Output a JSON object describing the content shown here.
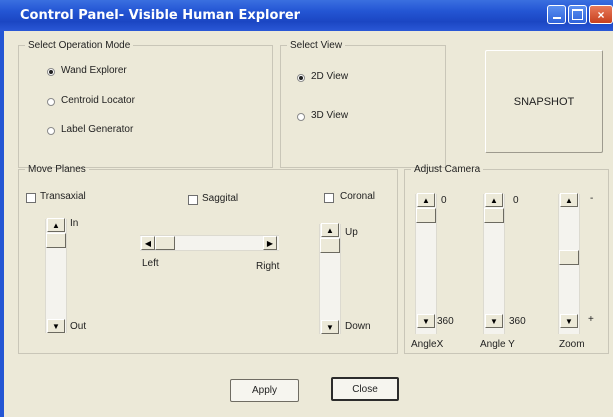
{
  "window": {
    "title": "Control Panel- Visible Human Explorer"
  },
  "operation_mode": {
    "legend": "Select Operation Mode",
    "options": [
      {
        "label": "Wand Explorer",
        "selected": true
      },
      {
        "label": "Centroid Locator",
        "selected": false
      },
      {
        "label": "Label Generator",
        "selected": false
      }
    ]
  },
  "view": {
    "legend": "Select View",
    "options": [
      {
        "label": "2D View",
        "selected": true
      },
      {
        "label": "3D View",
        "selected": false
      }
    ]
  },
  "snapshot_label": "SNAPSHOT",
  "move_planes": {
    "legend": "Move Planes",
    "transaxial": {
      "label": "Transaxial",
      "checked": false,
      "min_label": "In",
      "max_label": "Out"
    },
    "saggital": {
      "label": "Saggital",
      "checked": false,
      "min_label": "Left",
      "max_label": "Right"
    },
    "coronal": {
      "label": "Coronal",
      "checked": false,
      "min_label": "Up",
      "max_label": "Down"
    }
  },
  "camera": {
    "legend": "Adjust Camera",
    "angle_x": {
      "label": "AngleX",
      "min": "0",
      "max": "360"
    },
    "angle_y": {
      "label": "Angle Y",
      "min": "0",
      "max": "360"
    },
    "zoom": {
      "label": "Zoom",
      "min": "-",
      "max": "+"
    }
  },
  "buttons": {
    "apply": "Apply",
    "close": "Close"
  }
}
